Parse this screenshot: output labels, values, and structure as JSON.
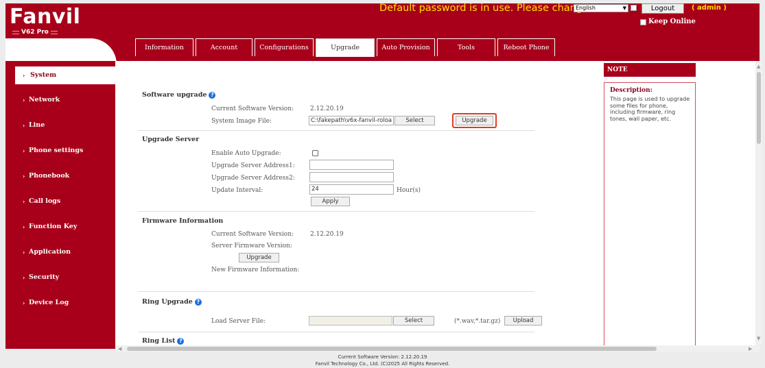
{
  "header": {
    "logo": "Fanvil",
    "model": "V62 Pro",
    "warning": "Default password is in use. Please change",
    "language": "English",
    "logout_label": "Logout",
    "user": "( admin )",
    "keep_online": "Keep Online"
  },
  "tabs": [
    {
      "label": "Information",
      "active": false
    },
    {
      "label": "Account",
      "active": false
    },
    {
      "label": "Configurations",
      "active": false
    },
    {
      "label": "Upgrade",
      "active": true
    },
    {
      "label": "Auto Provision",
      "active": false
    },
    {
      "label": "Tools",
      "active": false
    },
    {
      "label": "Reboot Phone",
      "active": false
    }
  ],
  "sidebar": {
    "items": [
      {
        "label": "System",
        "active": true
      },
      {
        "label": "Network"
      },
      {
        "label": "Line"
      },
      {
        "label": "Phone settings"
      },
      {
        "label": "Phonebook"
      },
      {
        "label": "Call logs"
      },
      {
        "label": "Function Key"
      },
      {
        "label": "Application"
      },
      {
        "label": "Security"
      },
      {
        "label": "Device Log"
      }
    ]
  },
  "software_upgrade": {
    "title": "Software upgrade",
    "current_version_label": "Current Software Version:",
    "current_version": "2.12.20.19",
    "image_label": "System Image File:",
    "image_path": "C:\\fakepath\\v6x-fanvil-roloa",
    "select_label": "Select",
    "upgrade_label": "Upgrade"
  },
  "upgrade_server": {
    "title": "Upgrade Server",
    "auto_label": "Enable Auto Upgrade:",
    "addr1_label": "Upgrade Server Address1:",
    "addr1_value": "",
    "addr2_label": "Upgrade Server Address2:",
    "addr2_value": "",
    "interval_label": "Update Interval:",
    "interval_value": "24",
    "interval_unit": "Hour(s)",
    "apply_label": "Apply"
  },
  "firmware_info": {
    "title": "Firmware Information",
    "current_label": "Current Software Version:",
    "current_value": "2.12.20.19",
    "server_label": "Server Firmware Version:",
    "upgrade_label": "Upgrade",
    "new_label": "New Firmware Information:"
  },
  "ring_upgrade": {
    "title": "Ring Upgrade",
    "load_label": "Load Server File:",
    "select_label": "Select",
    "ext_hint": "(*.wav,*.tar.gz)",
    "upload_label": "Upload"
  },
  "ring_list": {
    "title": "Ring List"
  },
  "note": {
    "header": "NOTE",
    "desc_title": "Description:",
    "desc_text": "This page is used to upgrade some files for phone, including firmware, ring tones, wall paper, etc."
  },
  "footer": {
    "line1": "Current Software Version: 2.12.20.19",
    "line2": "Fanvil Technology Co., Ltd. (C)2025 All Rights Reserved."
  },
  "colors": {
    "brand": "#a8001a",
    "warning": "#ffe000",
    "highlight": "#e03a1e",
    "help": "#1e6fd9"
  }
}
